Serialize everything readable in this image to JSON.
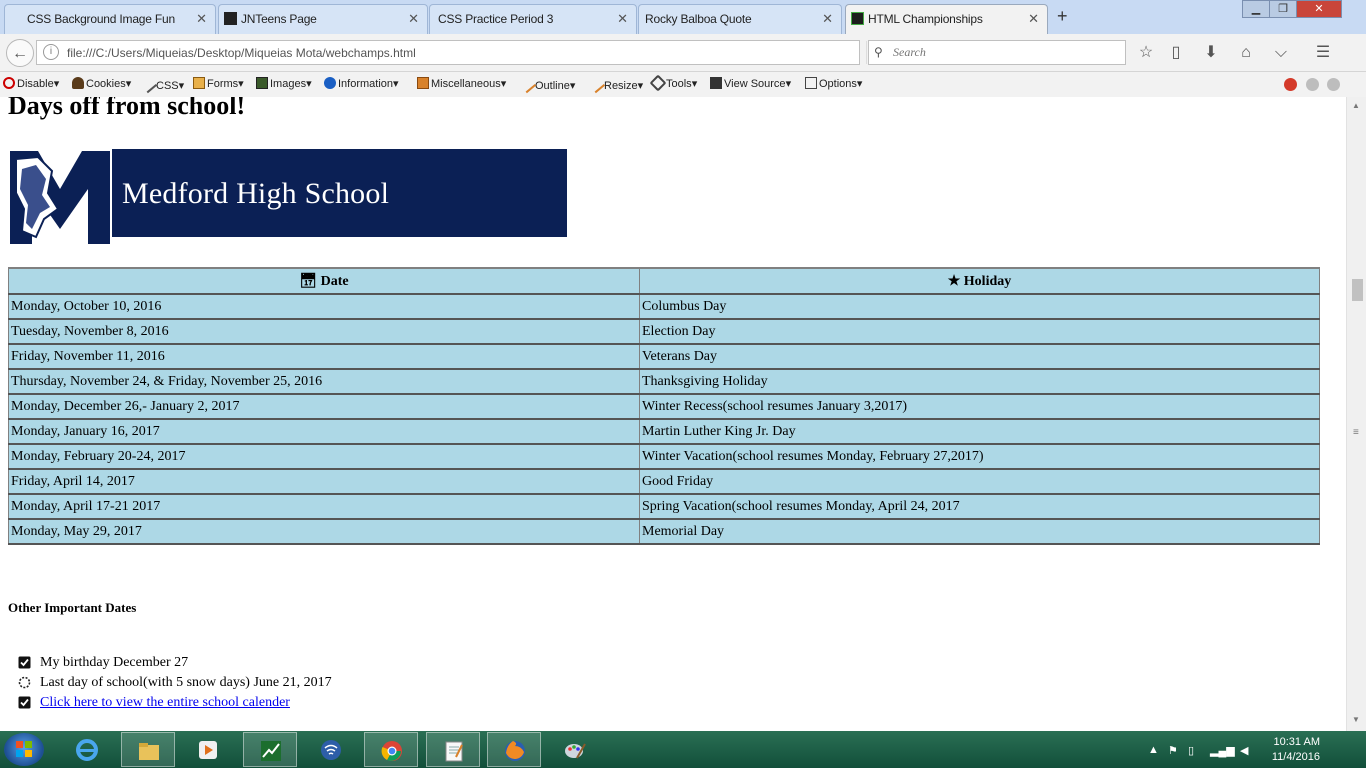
{
  "browser": {
    "tabs": [
      {
        "title": "CSS Background Image Fun",
        "active": false
      },
      {
        "title": "JNTeens Page",
        "active": false
      },
      {
        "title": "CSS Practice Period 3",
        "active": false
      },
      {
        "title": "Rocky Balboa Quote",
        "active": false
      },
      {
        "title": "HTML Championships",
        "active": true
      }
    ],
    "url": "file:///C:/Users/Miqueias/Desktop/Miqueias Mota/webchamps.html",
    "search_placeholder": "Search"
  },
  "devtoolbar": {
    "items": [
      "Disable",
      "Cookies",
      "CSS",
      "Forms",
      "Images",
      "Information",
      "Miscellaneous",
      "Outline",
      "Resize",
      "Tools",
      "View Source",
      "Options"
    ]
  },
  "page": {
    "heading": "Days off from school!",
    "banner_text": "Medford High School",
    "table": {
      "headers": [
        "Date",
        "Holiday"
      ],
      "rows": [
        [
          "Monday, October 10, 2016",
          "Columbus Day"
        ],
        [
          "Tuesday, November 8, 2016",
          "Election Day"
        ],
        [
          "Friday, November 11, 2016",
          "Veterans Day"
        ],
        [
          "Thursday, November 24, & Friday, November 25, 2016",
          "Thanksgiving Holiday"
        ],
        [
          "Monday, December 26,- January 2, 2017",
          "Winter Recess(school resumes January 3,2017)"
        ],
        [
          "Monday, January 16, 2017",
          "Martin Luther King Jr. Day"
        ],
        [
          "Monday, February 20-24, 2017",
          "Winter Vacation(school resumes Monday, February 27,2017)"
        ],
        [
          "Friday, April 14, 2017",
          "Good Friday"
        ],
        [
          "Monday, April 17-21 2017",
          "Spring Vacation(school resumes Monday, April 24, 2017"
        ],
        [
          "Monday, May 29, 2017",
          "Memorial Day"
        ]
      ]
    },
    "other_heading": "Other Important Dates",
    "list": [
      {
        "text": "My birthday December 27",
        "icon": "checked-box-icon"
      },
      {
        "text": "Last day of school(with 5 snow days) June 21, 2017",
        "icon": "loading-circle-icon"
      },
      {
        "text": "Click here to view the entire school calender",
        "icon": "checked-box-icon",
        "link": true
      }
    ]
  },
  "taskbar": {
    "apps": [
      "internet-explorer",
      "file-explorer",
      "media-player",
      "stock-app",
      "network-app",
      "chrome",
      "notepad",
      "firefox",
      "paint"
    ],
    "time": "10:31 AM",
    "date": "11/4/2016"
  },
  "colors": {
    "table_bg": "#add8e6",
    "banner_bg": "#0b2055",
    "link": "#0000ee",
    "taskbar": "#1f5f47"
  }
}
